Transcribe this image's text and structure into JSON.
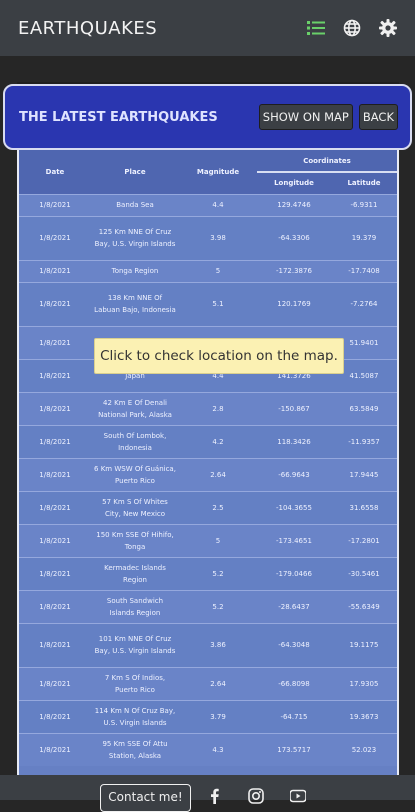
{
  "app": {
    "title": "EARTHQUAKES"
  },
  "nav": {
    "icons": [
      "list-icon",
      "globe-icon",
      "gear-icon"
    ],
    "active_color": "#6ad06a"
  },
  "header": {
    "title": "THE LATEST EARTHQUAKES",
    "show_on_map": "SHOW ON MAP",
    "back": "BACK"
  },
  "table": {
    "headers": {
      "date": "Date",
      "place": "Place",
      "magnitude": "Magnitude",
      "coordinates": "Coordinates",
      "longitude": "Longitude",
      "latitude": "Latitude"
    },
    "rows": [
      {
        "date": "1/8/2021",
        "place": "Banda Sea",
        "magnitude": "4.4",
        "longitude": "129.4746",
        "latitude": "-6.9311"
      },
      {
        "date": "1/8/2021",
        "place": "125 Km NNE Of Cruz Bay, U.S. Virgin Islands",
        "magnitude": "3.98",
        "longitude": "-64.3306",
        "latitude": "19.379"
      },
      {
        "date": "1/8/2021",
        "place": "Tonga Region",
        "magnitude": "5",
        "longitude": "-172.3876",
        "latitude": "-17.7408"
      },
      {
        "date": "1/8/2021",
        "place": "138 Km NNE Of Labuan Bajo, Indonesia",
        "magnitude": "5.1",
        "longitude": "120.1769",
        "latitude": "-7.2764"
      },
      {
        "date": "1/8/2021",
        "place": "",
        "magnitude": "",
        "longitude": "",
        "latitude": "51.9401"
      },
      {
        "date": "1/8/2021",
        "place": "Japan",
        "magnitude": "4.4",
        "longitude": "141.3726",
        "latitude": "41.5087"
      },
      {
        "date": "1/8/2021",
        "place": "42 Km E Of Denali National Park, Alaska",
        "magnitude": "2.8",
        "longitude": "-150.867",
        "latitude": "63.5849"
      },
      {
        "date": "1/8/2021",
        "place": "South Of Lombok, Indonesia",
        "magnitude": "4.2",
        "longitude": "118.3426",
        "latitude": "-11.9357"
      },
      {
        "date": "1/8/2021",
        "place": "6 Km WSW Of Guánica, Puerto Rico",
        "magnitude": "2.64",
        "longitude": "-66.9643",
        "latitude": "17.9445"
      },
      {
        "date": "1/8/2021",
        "place": "57 Km S Of Whites City, New Mexico",
        "magnitude": "2.5",
        "longitude": "-104.3655",
        "latitude": "31.6558"
      },
      {
        "date": "1/8/2021",
        "place": "150 Km SSE Of Hihifo, Tonga",
        "magnitude": "5",
        "longitude": "-173.4651",
        "latitude": "-17.2801"
      },
      {
        "date": "1/8/2021",
        "place": "Kermadec Islands Region",
        "magnitude": "5.2",
        "longitude": "-179.0466",
        "latitude": "-30.5461"
      },
      {
        "date": "1/8/2021",
        "place": "South Sandwich Islands Region",
        "magnitude": "5.2",
        "longitude": "-28.6437",
        "latitude": "-55.6349"
      },
      {
        "date": "1/8/2021",
        "place": "101 Km NNE Of Cruz Bay, U.S. Virgin Islands",
        "magnitude": "3.86",
        "longitude": "-64.3048",
        "latitude": "19.1175"
      },
      {
        "date": "1/8/2021",
        "place": "7 Km S Of Indios, Puerto Rico",
        "magnitude": "2.64",
        "longitude": "-66.8098",
        "latitude": "17.9305"
      },
      {
        "date": "1/8/2021",
        "place": "114 Km N Of Cruz Bay, U.S. Virgin Islands",
        "magnitude": "3.79",
        "longitude": "-64.715",
        "latitude": "19.3673"
      },
      {
        "date": "1/8/2021",
        "place": "95 Km SSE Of Attu Station, Alaska",
        "magnitude": "4.3",
        "longitude": "173.5717",
        "latitude": "52.023"
      }
    ]
  },
  "tooltip": {
    "text": "Click to check location on the map."
  },
  "footer": {
    "contact": "Contact me!",
    "social_icons": [
      "facebook-icon",
      "instagram-icon",
      "youtube-icon"
    ]
  }
}
